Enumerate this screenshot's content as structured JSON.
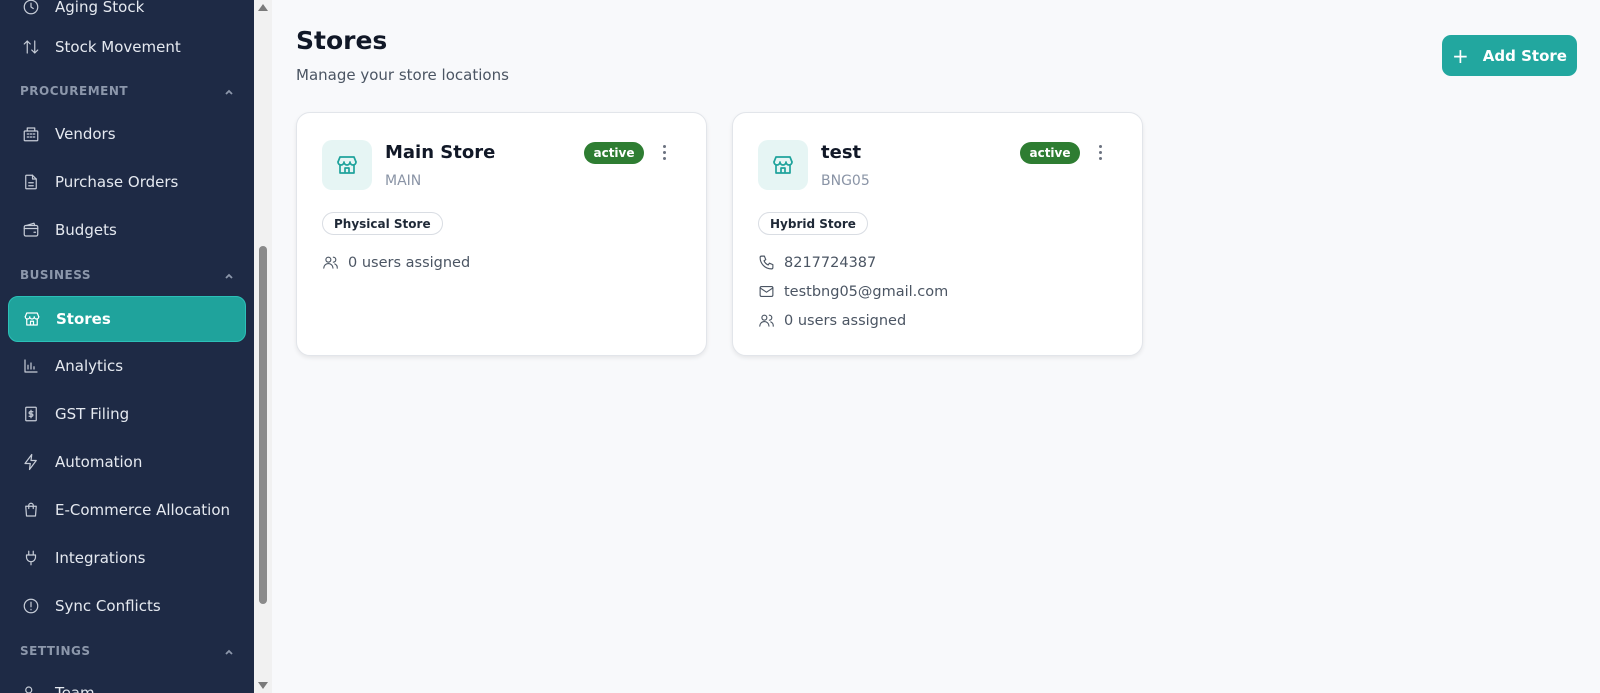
{
  "sidebar": {
    "partial_top": "Aging Stock",
    "stock_movement": "Stock Movement",
    "procurement_header": "PROCUREMENT",
    "vendors": "Vendors",
    "purchase_orders": "Purchase Orders",
    "budgets": "Budgets",
    "business_header": "BUSINESS",
    "stores": "Stores",
    "analytics": "Analytics",
    "gst_filing": "GST Filing",
    "automation": "Automation",
    "ecommerce": "E-Commerce Allocation",
    "integrations": "Integrations",
    "sync_conflicts": "Sync Conflicts",
    "settings_header": "SETTINGS",
    "partial_bottom": "Team"
  },
  "main": {
    "title": "Stores",
    "subtitle": "Manage your store locations",
    "add_button": "Add Store",
    "add_button_icon": "+"
  },
  "stores": [
    {
      "name": "Main Store",
      "code": "MAIN",
      "status": "active",
      "type": "Physical Store",
      "users": "0 users assigned"
    },
    {
      "name": "test",
      "code": "BNG05",
      "status": "active",
      "type": "Hybrid Store",
      "phone": "8217724387",
      "email": "testbng05@gmail.com",
      "users": "0 users assigned"
    }
  ],
  "colors": {
    "sidebar_bg": "#1e2a45",
    "accent": "#1fa39c",
    "active_badge": "#2e7d32"
  }
}
